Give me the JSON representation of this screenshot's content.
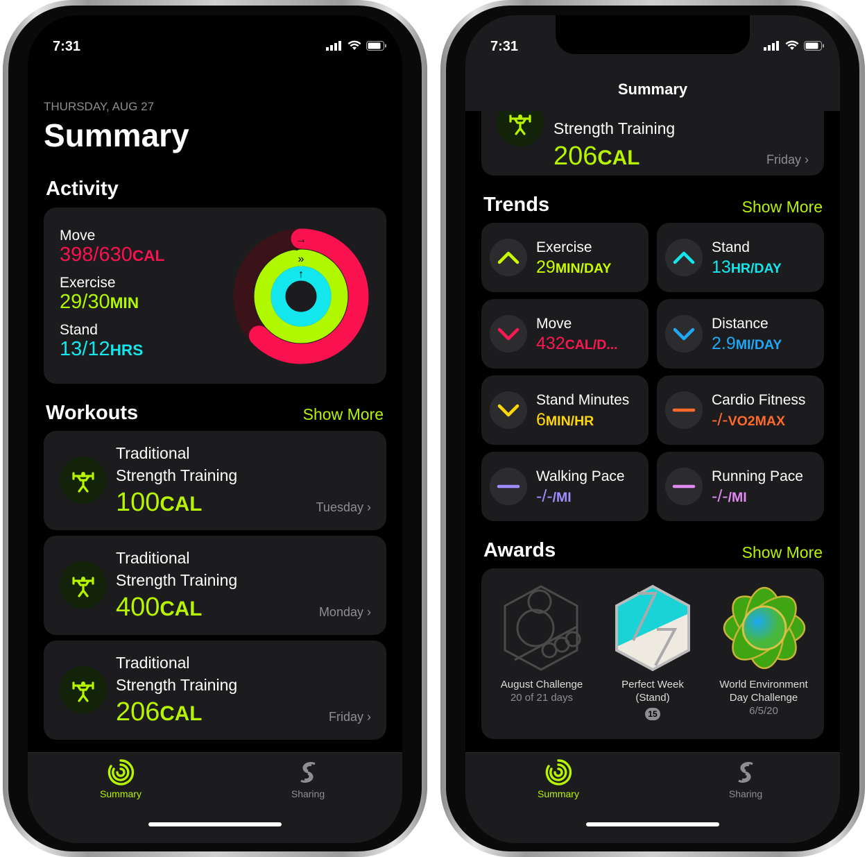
{
  "status": {
    "time": "7:31"
  },
  "left": {
    "date": "THURSDAY, AUG 27",
    "title": "Summary",
    "activity": {
      "heading": "Activity",
      "move": {
        "label": "Move",
        "value": "398/630",
        "unit": "CAL",
        "progress": 0.63,
        "color": "#fa1150"
      },
      "exercise": {
        "label": "Exercise",
        "value": "29/30",
        "unit": "MIN",
        "progress": 0.97,
        "color": "#b0f800"
      },
      "stand": {
        "label": "Stand",
        "value": "13/12",
        "unit": "HRS",
        "progress": 1.08,
        "color": "#14e6ee"
      }
    },
    "workouts": {
      "heading": "Workouts",
      "show_more": "Show More",
      "items": [
        {
          "title1": "Traditional",
          "title2": "Strength Training",
          "value": "100",
          "unit": "CAL",
          "day": "Tuesday"
        },
        {
          "title1": "Traditional",
          "title2": "Strength Training",
          "value": "400",
          "unit": "CAL",
          "day": "Monday"
        },
        {
          "title1": "Traditional",
          "title2": "Strength Training",
          "value": "206",
          "unit": "CAL",
          "day": "Friday"
        }
      ]
    }
  },
  "right": {
    "nav_title": "Summary",
    "workout": {
      "title": "Strength Training",
      "value": "206",
      "unit": "CAL",
      "day": "Friday"
    },
    "trends": {
      "heading": "Trends",
      "show_more": "Show More",
      "items": [
        {
          "label": "Exercise",
          "value": "29",
          "unit": "MIN/DAY",
          "dir": "up",
          "color": "#c8fa00"
        },
        {
          "label": "Stand",
          "value": "13",
          "unit": "HR/DAY",
          "dir": "up",
          "color": "#14e6ee"
        },
        {
          "label": "Move",
          "value": "432",
          "unit": "CAL/D...",
          "dir": "down",
          "color": "#fa1752"
        },
        {
          "label": "Distance",
          "value": "2.9",
          "unit": "MI/DAY",
          "dir": "down",
          "color": "#1ea8f5"
        },
        {
          "label": "Stand Minutes",
          "value": "6",
          "unit": "MIN/HR",
          "dir": "down",
          "color": "#ffd60a"
        },
        {
          "label": "Cardio Fitness",
          "value": "-/-",
          "unit": "VO2MAX",
          "dir": "flat",
          "color": "#ff6a2c"
        },
        {
          "label": "Walking Pace",
          "value": "-/-",
          "unit": "/MI",
          "dir": "flat",
          "color": "#a08cff"
        },
        {
          "label": "Running Pace",
          "value": "-/-",
          "unit": "/MI",
          "dir": "flat",
          "color": "#e08af2"
        }
      ]
    },
    "awards": {
      "heading": "Awards",
      "show_more": "Show More",
      "items": [
        {
          "name": "August Challenge",
          "sub": "20 of 21 days"
        },
        {
          "name": "Perfect Week",
          "name2": "(Stand)",
          "badge": "15"
        },
        {
          "name": "World Environment",
          "name2": "Day Challenge",
          "sub": "6/5/20"
        }
      ]
    }
  },
  "tabs": [
    {
      "label": "Summary",
      "active": true
    },
    {
      "label": "Sharing",
      "active": false
    }
  ],
  "colors": {
    "accent": "#b6f400",
    "card": "#1c1c1e"
  }
}
